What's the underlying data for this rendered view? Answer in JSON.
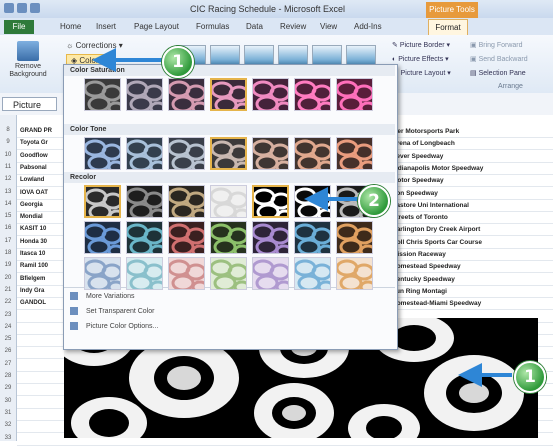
{
  "window": {
    "title": "CIC Racing Schedule - Microsoft Excel",
    "picture_tools_label": "Picture Tools"
  },
  "tabs": [
    "File",
    "Home",
    "Insert",
    "Page Layout",
    "Formulas",
    "Data",
    "Review",
    "View",
    "Add-Ins",
    "Format"
  ],
  "ribbon": {
    "remove_background": "Remove Background",
    "corrections": "Corrections",
    "color": "Color",
    "picture_border": "Picture Border",
    "picture_effects": "Picture Effects",
    "picture_layout": "Picture Layout",
    "bring_forward": "Bring Forward",
    "send_backward": "Send Backward",
    "selection_pane": "Selection Pane",
    "arrange": "Arrange"
  },
  "name_box": "Picture",
  "dropdown": {
    "color_saturation": "Color Saturation",
    "color_tone": "Color Tone",
    "recolor": "Recolor",
    "more_variations": "More Variations",
    "set_transparent": "Set Transparent Color",
    "picture_color_options": "Picture Color Options..."
  },
  "row_numbers": [
    "8",
    "9",
    "10",
    "11",
    "12",
    "13",
    "14",
    "15",
    "16",
    "17",
    "18",
    "19",
    "20",
    "21",
    "22",
    "23",
    "24",
    "25",
    "26",
    "27",
    "28",
    "29",
    "30",
    "31",
    "32",
    "33"
  ],
  "left_cells": [
    "GRAND PR",
    "Toyota Gr",
    "Goodflow",
    "Pabsonal",
    "Lowland",
    "IOVA OAT",
    "Georgia",
    "Mondial",
    "KASIT 10",
    "Honda 30",
    "Itasca 10",
    "Ramil 100",
    "Bfielgem",
    "Indy Gra",
    "GANDOL"
  ],
  "right_cells": [
    "Mer Motorsports Park",
    "Arena of Longbeach",
    "Sever Speedway",
    "Indianapolis Motor Speedway",
    "Motor Speedway",
    "Iron Speedway",
    "Pastore Uni International",
    "Streets of Toronto",
    "Darlington Dry Creek Airport",
    "Roll Chris Sports Car Course",
    "Mission Raceway",
    "Homestead Speedway",
    "Kentucky Speedway",
    "Fun Ring Montagi",
    "Homestead-Miami Speedway"
  ],
  "callouts": {
    "top": "1",
    "middle": "2",
    "bottom": "1"
  },
  "colors": {
    "file_tab": "#2e7a3a",
    "picture_tools": "#e79a3c",
    "callout_green": "#2f9a3a",
    "arrow_blue": "#2e86d6",
    "selection_border": "#e5b44b"
  }
}
